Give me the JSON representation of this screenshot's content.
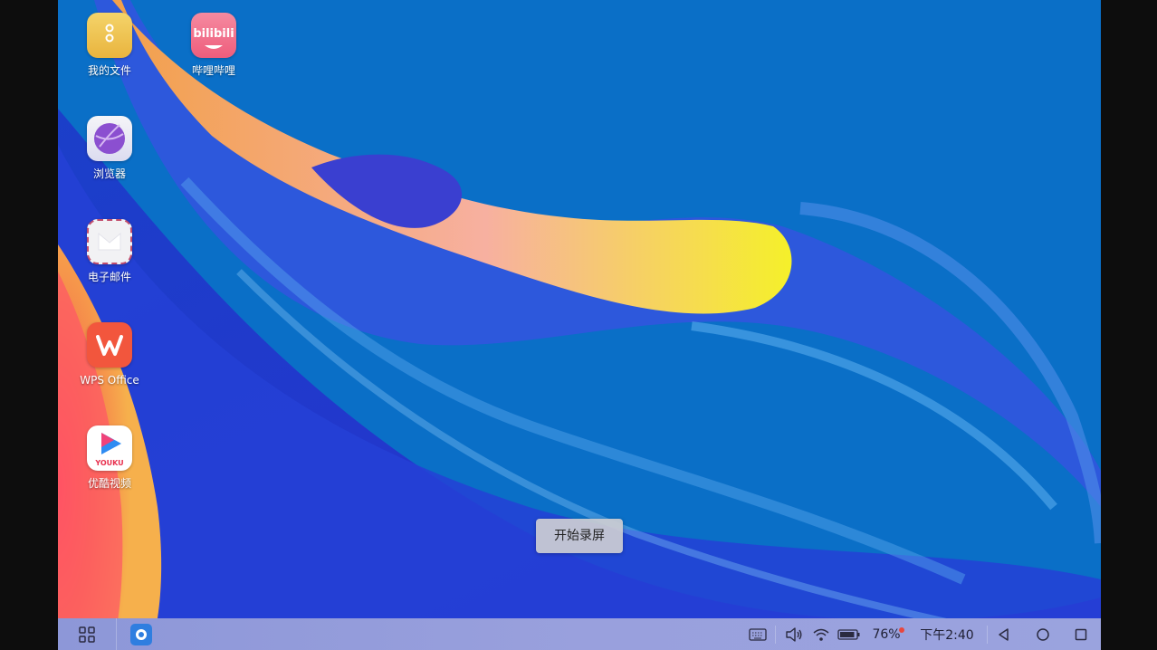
{
  "desktop": {
    "apps": [
      {
        "label": "我的文件",
        "icon": "file-manager-icon"
      },
      {
        "label": "哔哩哔哩",
        "icon": "bilibili-icon",
        "logo_text": "bilibili"
      },
      {
        "label": "浏览器",
        "icon": "browser-icon"
      },
      {
        "label": "电子邮件",
        "icon": "email-icon"
      },
      {
        "label": "WPS Office",
        "icon": "wps-icon"
      },
      {
        "label": "优酷视频",
        "icon": "youku-icon",
        "logo_text": "YOUKU"
      }
    ]
  },
  "recording": {
    "button_label": "开始录屏"
  },
  "taskbar": {
    "start_icon": "app-grid-icon",
    "pinned_app_icon": "browser-icon",
    "tray": {
      "keyboard_icon": "keyboard-icon",
      "volume_icon": "volume-icon",
      "wifi_icon": "wifi-icon",
      "battery_icon": "battery-icon",
      "battery_level": "76%",
      "time": "下午2:40"
    },
    "nav": [
      "back-icon",
      "home-icon",
      "recents-icon"
    ]
  },
  "colors": {
    "desktop_bg": "#0a6ec6",
    "taskbar": "#939cdb",
    "notification_dot": "#e8463d"
  }
}
